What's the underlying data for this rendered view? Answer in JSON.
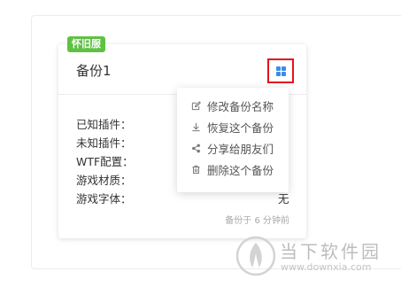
{
  "card": {
    "tag": "怀旧服",
    "title": "备份1",
    "info_labels": [
      "已知插件：",
      "未知插件：",
      "WTF配置：",
      "游戏材质：",
      "游戏字体："
    ],
    "font_value": "无",
    "backup_time": "备份于 6 分钟前"
  },
  "menu": {
    "items": [
      {
        "label": "修改备份名称",
        "icon": "edit-icon"
      },
      {
        "label": "恢复这个备份",
        "icon": "download-icon"
      },
      {
        "label": "分享给朋友们",
        "icon": "share-icon"
      },
      {
        "label": "删除这个备份",
        "icon": "trash-icon"
      }
    ]
  },
  "watermark": {
    "name": "当下软件园",
    "url": "www.downxia.com"
  },
  "colors": {
    "tag_green": "#5fc143",
    "icon_blue": "#3a8ee6",
    "highlight_red": "#e4141b"
  }
}
